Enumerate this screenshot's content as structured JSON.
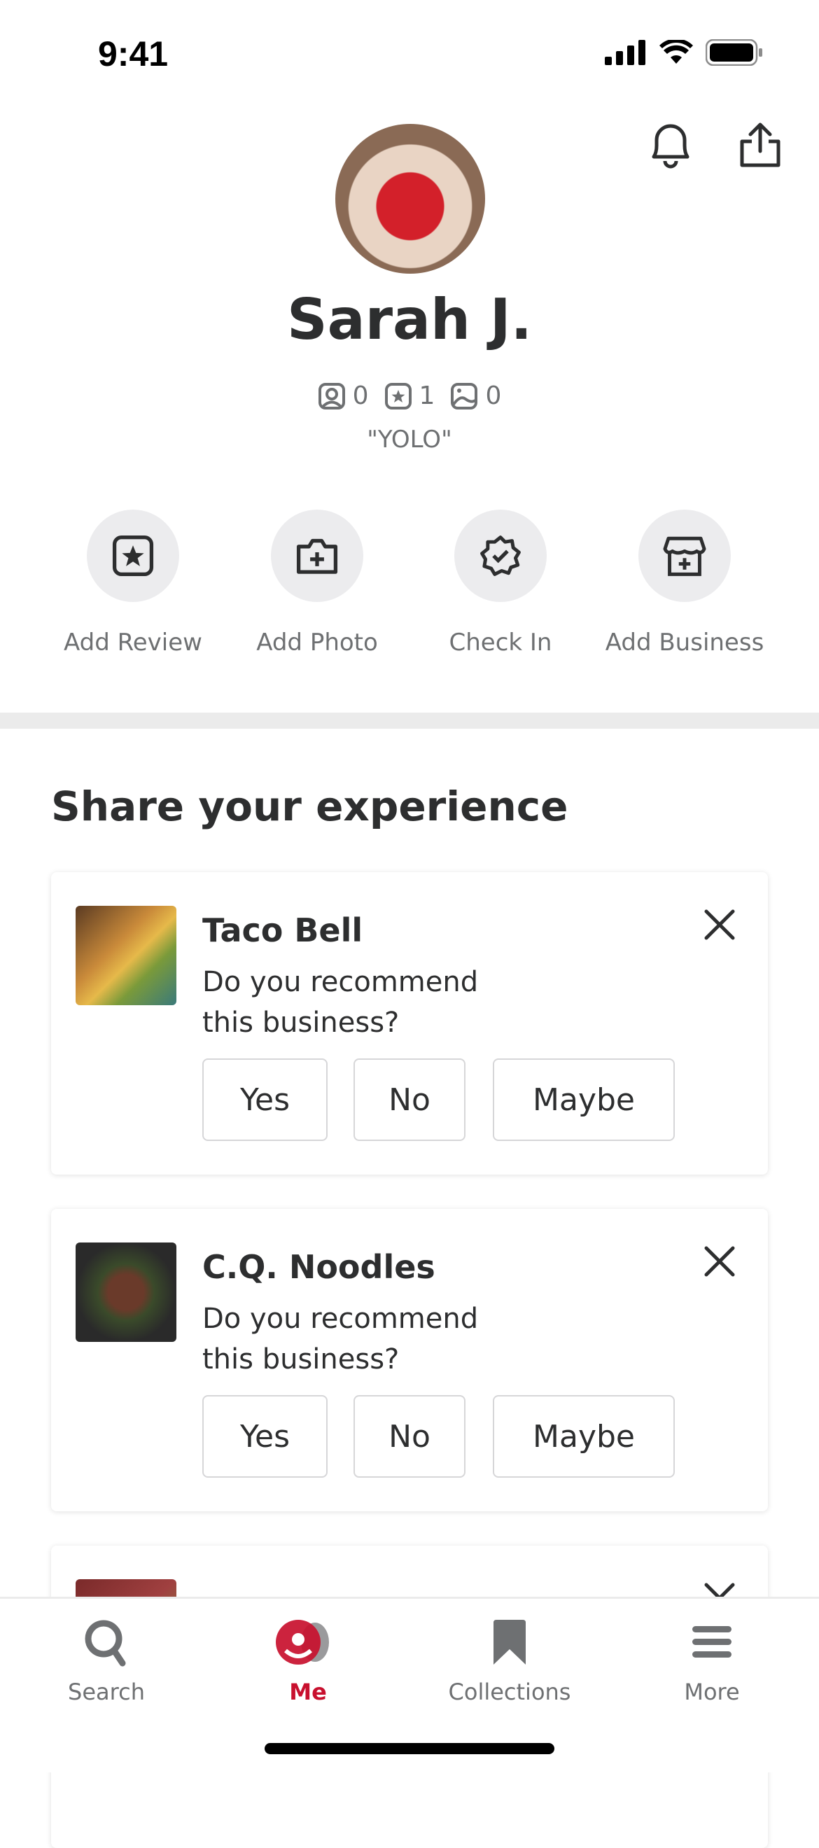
{
  "status_bar": {
    "time": "9:41"
  },
  "header": {
    "icons": [
      "bell-icon",
      "share-icon"
    ]
  },
  "profile": {
    "name": "Sarah J.",
    "stats": {
      "friends": "0",
      "reviews": "1",
      "photos": "0"
    },
    "tagline": "\"YOLO\""
  },
  "actions": [
    {
      "label": "Add Review",
      "icon": "star-square-icon"
    },
    {
      "label": "Add Photo",
      "icon": "camera-plus-icon"
    },
    {
      "label": "Check In",
      "icon": "badge-check-icon"
    },
    {
      "label": "Add Business",
      "icon": "storefront-plus-icon"
    }
  ],
  "section": {
    "title": "Share your experience"
  },
  "cards": [
    {
      "title": "Taco Bell",
      "question": "Do you recommend this business?",
      "buttons": [
        "Yes",
        "No",
        "Maybe"
      ]
    },
    {
      "title": "C.Q. Noodles",
      "question": "Do you recommend this business?",
      "buttons": [
        "Yes",
        "No",
        "Maybe"
      ]
    }
  ],
  "tabbar": {
    "items": [
      {
        "label": "Search"
      },
      {
        "label": "Me",
        "active": true
      },
      {
        "label": "Collections"
      },
      {
        "label": "More"
      }
    ],
    "active_color": "#c8102e",
    "inactive_color": "#6e7072"
  }
}
